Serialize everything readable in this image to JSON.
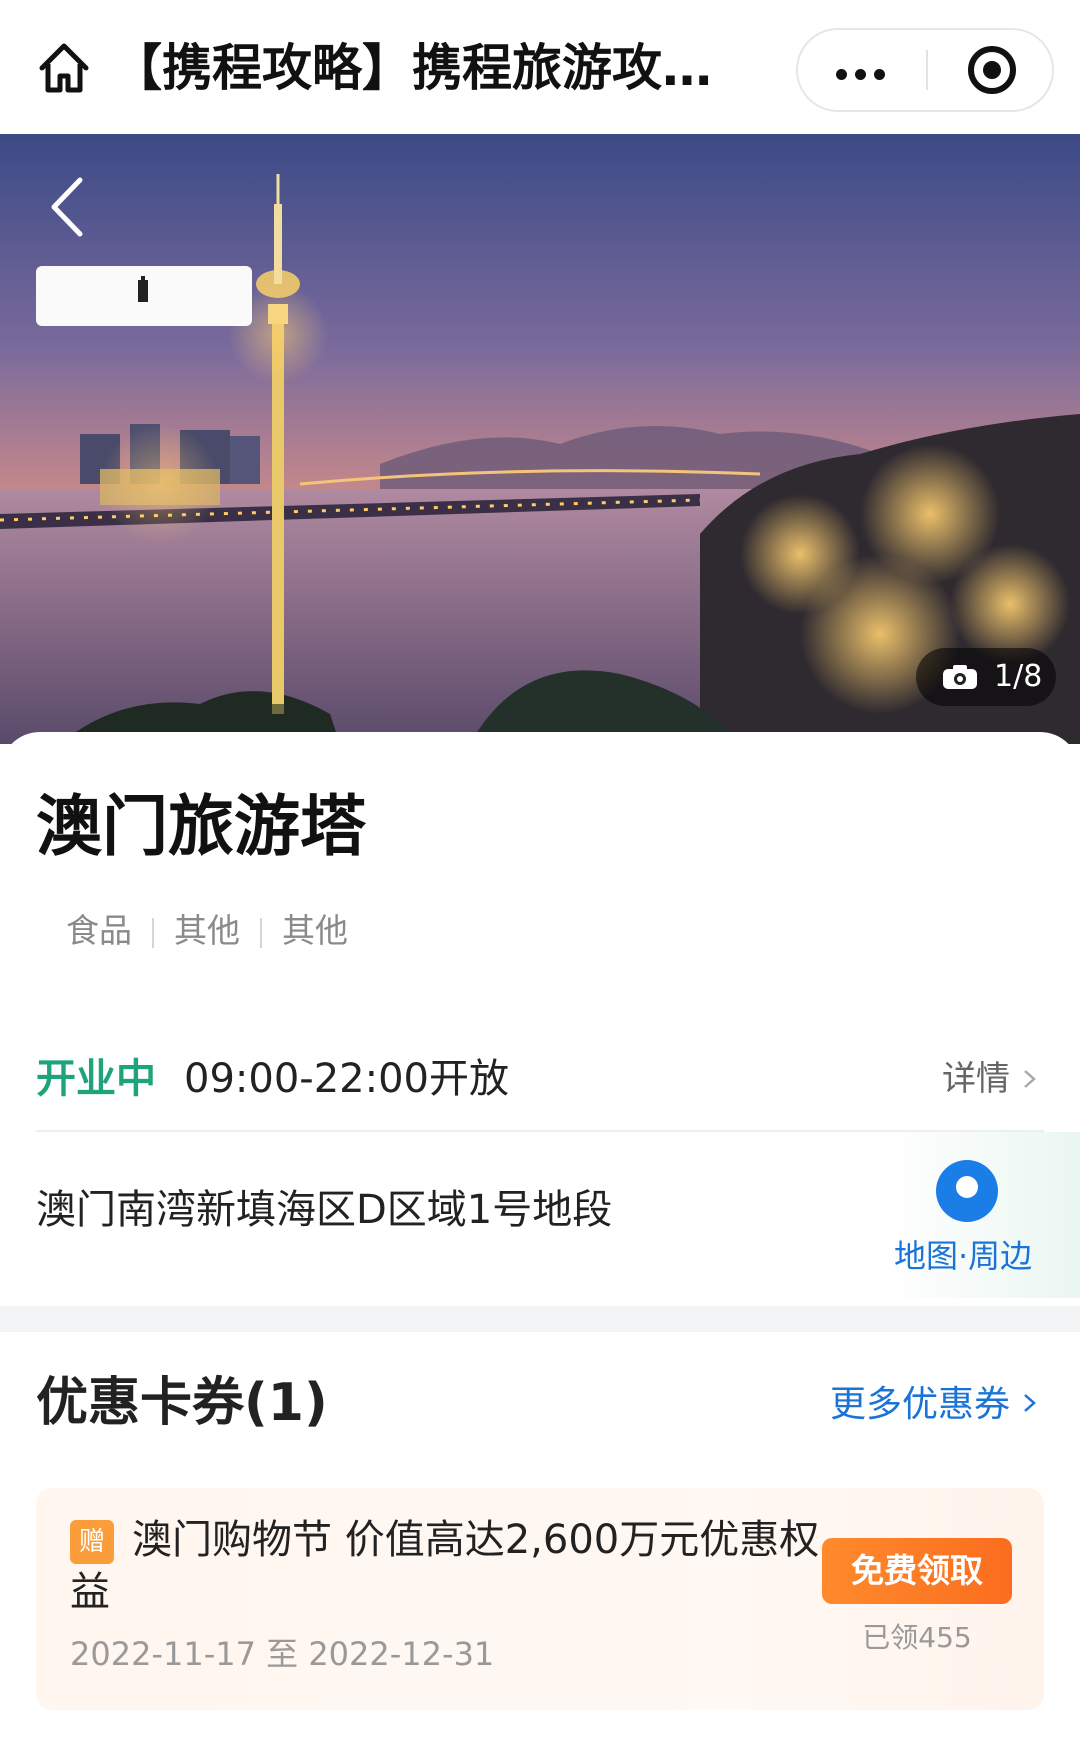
{
  "topbar": {
    "title": "【携程攻略】携程旅游攻…",
    "icons": {
      "home": "home-icon",
      "more": "more-dots-icon",
      "close": "close-ring-icon"
    }
  },
  "hero": {
    "photo_counter": "1/8",
    "icons": {
      "back": "back-chevron-icon",
      "camera": "camera-icon"
    },
    "logo": "macau-tower-logo"
  },
  "poi": {
    "title": "澳门旅游塔",
    "tags": [
      "食品",
      "其他",
      "其他"
    ],
    "status": "开业中",
    "status_color": "#1fa37a",
    "hours": "09:00-22:00开放",
    "detail_label": "详情",
    "address": "澳门南湾新填海区D区域1号地段",
    "map_label": "地图·周边"
  },
  "coupons": {
    "header": "优惠卡券(1)",
    "more_label": "更多优惠券",
    "items": [
      {
        "badge": "赠",
        "name": "澳门购物节 价值高达2,600万元优惠权益",
        "date_range": "2022-11-17 至 2022-12-31",
        "button_label": "免费领取",
        "claimed": "已领455"
      }
    ]
  },
  "colors": {
    "accent_blue": "#1a73d8",
    "claim_orange": "#fb6d1f",
    "badge_orange": "#fb9d3a"
  }
}
